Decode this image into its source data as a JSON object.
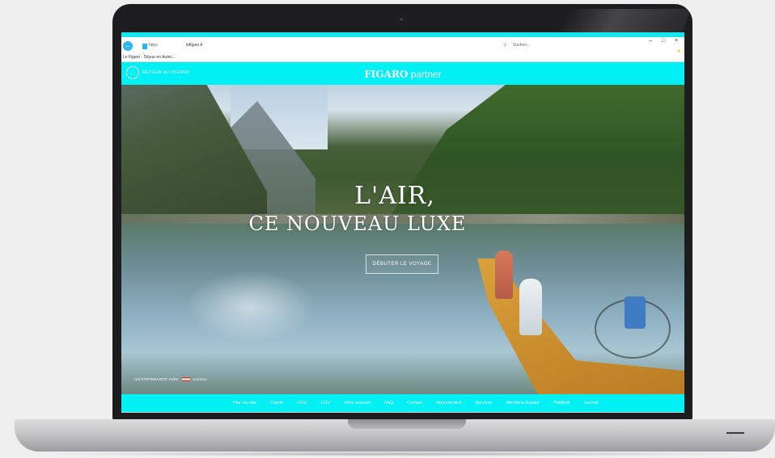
{
  "browser": {
    "url_scheme": "https",
    "url_host": "lefigaro.fr",
    "search_placeholder": "Suchen...",
    "favorite_label": "Le Figaro - Séjour en Autric...",
    "window_controls": {
      "minimize": "–",
      "maximize": "□",
      "close": "×"
    }
  },
  "header": {
    "return_label": "RETOUR AU FIGARO",
    "brand_bold": "FIGARO",
    "brand_light": " partner"
  },
  "hero": {
    "title_line1": "L'AIR,",
    "title_line2": "CE NOUVEAU LUXE",
    "cta_label": "DÉBUTER LE VOYAGE",
    "partner_text": "UN PARTENARIAT AVEC",
    "partner_brand": "Autriche"
  },
  "footer": {
    "links": [
      "Plan du site",
      "Charte",
      "CGU",
      "CGV",
      "Infos sources",
      "FAQ",
      "Contact",
      "Abonnement",
      "Services",
      "Mentions légales",
      "Publicité",
      "Journal"
    ]
  },
  "colors": {
    "accent": "#00f0f4",
    "laptop_frame": "#1d1d1f",
    "background": "#efefef"
  }
}
